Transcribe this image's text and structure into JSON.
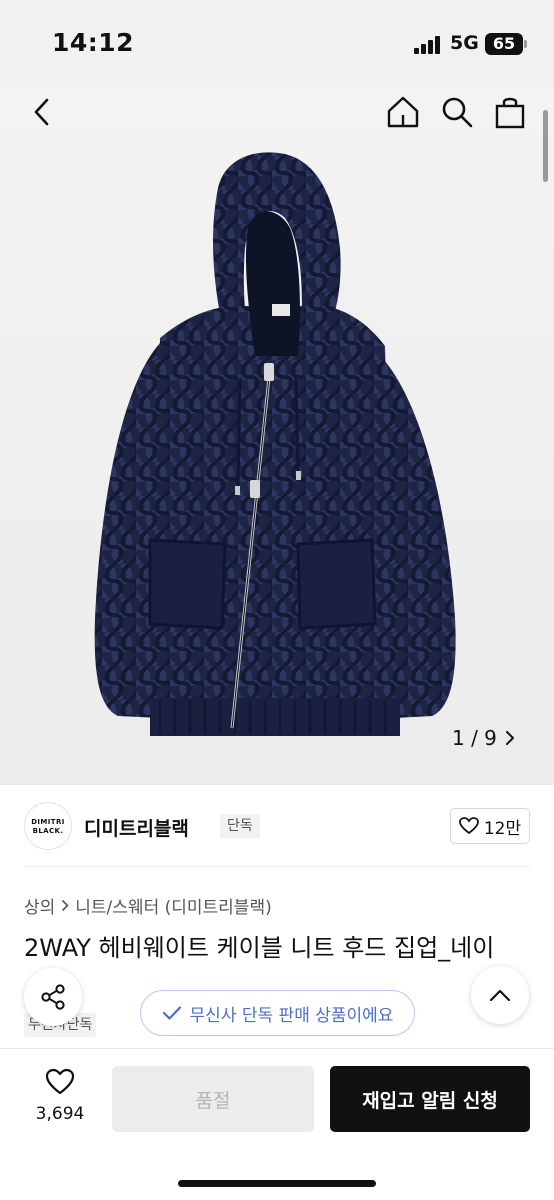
{
  "status_bar": {
    "time": "14:12",
    "network": "5G",
    "battery": "65"
  },
  "gallery": {
    "counter": "1 / 9"
  },
  "brand": {
    "logo_text": "DIMITRI BLACK.",
    "name": "디미트리블랙",
    "tag": "단독",
    "likes": "12만"
  },
  "product": {
    "category_top": "상의",
    "category_sub": "니트/스웨터 (디미트리블랙)",
    "title": "2WAY 헤비웨이트 케이블 니트 후드 집업_네이",
    "tag": "무신사단독"
  },
  "notice": {
    "text": "무신사 단독 판매 상품이에요"
  },
  "bottom_bar": {
    "wish_count": "3,694",
    "soldout_label": "품절",
    "restock_label": "재입고 알림 신청"
  },
  "colors": {
    "accent_blue": "#4d6fc4",
    "navy_knit": "#1b2240",
    "primary_button": "#111111"
  }
}
